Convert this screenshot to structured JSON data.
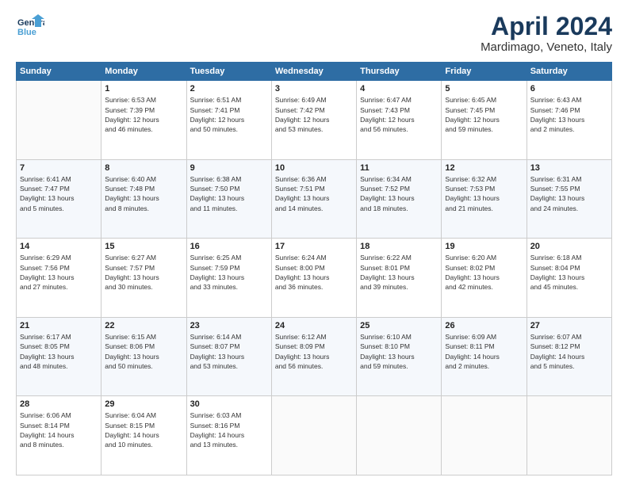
{
  "header": {
    "logo_line1": "General",
    "logo_line2": "Blue",
    "title": "April 2024",
    "subtitle": "Mardimago, Veneto, Italy"
  },
  "weekdays": [
    "Sunday",
    "Monday",
    "Tuesday",
    "Wednesday",
    "Thursday",
    "Friday",
    "Saturday"
  ],
  "weeks": [
    [
      {
        "day": "",
        "detail": ""
      },
      {
        "day": "1",
        "detail": "Sunrise: 6:53 AM\nSunset: 7:39 PM\nDaylight: 12 hours\nand 46 minutes."
      },
      {
        "day": "2",
        "detail": "Sunrise: 6:51 AM\nSunset: 7:41 PM\nDaylight: 12 hours\nand 50 minutes."
      },
      {
        "day": "3",
        "detail": "Sunrise: 6:49 AM\nSunset: 7:42 PM\nDaylight: 12 hours\nand 53 minutes."
      },
      {
        "day": "4",
        "detail": "Sunrise: 6:47 AM\nSunset: 7:43 PM\nDaylight: 12 hours\nand 56 minutes."
      },
      {
        "day": "5",
        "detail": "Sunrise: 6:45 AM\nSunset: 7:45 PM\nDaylight: 12 hours\nand 59 minutes."
      },
      {
        "day": "6",
        "detail": "Sunrise: 6:43 AM\nSunset: 7:46 PM\nDaylight: 13 hours\nand 2 minutes."
      }
    ],
    [
      {
        "day": "7",
        "detail": "Sunrise: 6:41 AM\nSunset: 7:47 PM\nDaylight: 13 hours\nand 5 minutes."
      },
      {
        "day": "8",
        "detail": "Sunrise: 6:40 AM\nSunset: 7:48 PM\nDaylight: 13 hours\nand 8 minutes."
      },
      {
        "day": "9",
        "detail": "Sunrise: 6:38 AM\nSunset: 7:50 PM\nDaylight: 13 hours\nand 11 minutes."
      },
      {
        "day": "10",
        "detail": "Sunrise: 6:36 AM\nSunset: 7:51 PM\nDaylight: 13 hours\nand 14 minutes."
      },
      {
        "day": "11",
        "detail": "Sunrise: 6:34 AM\nSunset: 7:52 PM\nDaylight: 13 hours\nand 18 minutes."
      },
      {
        "day": "12",
        "detail": "Sunrise: 6:32 AM\nSunset: 7:53 PM\nDaylight: 13 hours\nand 21 minutes."
      },
      {
        "day": "13",
        "detail": "Sunrise: 6:31 AM\nSunset: 7:55 PM\nDaylight: 13 hours\nand 24 minutes."
      }
    ],
    [
      {
        "day": "14",
        "detail": "Sunrise: 6:29 AM\nSunset: 7:56 PM\nDaylight: 13 hours\nand 27 minutes."
      },
      {
        "day": "15",
        "detail": "Sunrise: 6:27 AM\nSunset: 7:57 PM\nDaylight: 13 hours\nand 30 minutes."
      },
      {
        "day": "16",
        "detail": "Sunrise: 6:25 AM\nSunset: 7:59 PM\nDaylight: 13 hours\nand 33 minutes."
      },
      {
        "day": "17",
        "detail": "Sunrise: 6:24 AM\nSunset: 8:00 PM\nDaylight: 13 hours\nand 36 minutes."
      },
      {
        "day": "18",
        "detail": "Sunrise: 6:22 AM\nSunset: 8:01 PM\nDaylight: 13 hours\nand 39 minutes."
      },
      {
        "day": "19",
        "detail": "Sunrise: 6:20 AM\nSunset: 8:02 PM\nDaylight: 13 hours\nand 42 minutes."
      },
      {
        "day": "20",
        "detail": "Sunrise: 6:18 AM\nSunset: 8:04 PM\nDaylight: 13 hours\nand 45 minutes."
      }
    ],
    [
      {
        "day": "21",
        "detail": "Sunrise: 6:17 AM\nSunset: 8:05 PM\nDaylight: 13 hours\nand 48 minutes."
      },
      {
        "day": "22",
        "detail": "Sunrise: 6:15 AM\nSunset: 8:06 PM\nDaylight: 13 hours\nand 50 minutes."
      },
      {
        "day": "23",
        "detail": "Sunrise: 6:14 AM\nSunset: 8:07 PM\nDaylight: 13 hours\nand 53 minutes."
      },
      {
        "day": "24",
        "detail": "Sunrise: 6:12 AM\nSunset: 8:09 PM\nDaylight: 13 hours\nand 56 minutes."
      },
      {
        "day": "25",
        "detail": "Sunrise: 6:10 AM\nSunset: 8:10 PM\nDaylight: 13 hours\nand 59 minutes."
      },
      {
        "day": "26",
        "detail": "Sunrise: 6:09 AM\nSunset: 8:11 PM\nDaylight: 14 hours\nand 2 minutes."
      },
      {
        "day": "27",
        "detail": "Sunrise: 6:07 AM\nSunset: 8:12 PM\nDaylight: 14 hours\nand 5 minutes."
      }
    ],
    [
      {
        "day": "28",
        "detail": "Sunrise: 6:06 AM\nSunset: 8:14 PM\nDaylight: 14 hours\nand 8 minutes."
      },
      {
        "day": "29",
        "detail": "Sunrise: 6:04 AM\nSunset: 8:15 PM\nDaylight: 14 hours\nand 10 minutes."
      },
      {
        "day": "30",
        "detail": "Sunrise: 6:03 AM\nSunset: 8:16 PM\nDaylight: 14 hours\nand 13 minutes."
      },
      {
        "day": "",
        "detail": ""
      },
      {
        "day": "",
        "detail": ""
      },
      {
        "day": "",
        "detail": ""
      },
      {
        "day": "",
        "detail": ""
      }
    ]
  ]
}
